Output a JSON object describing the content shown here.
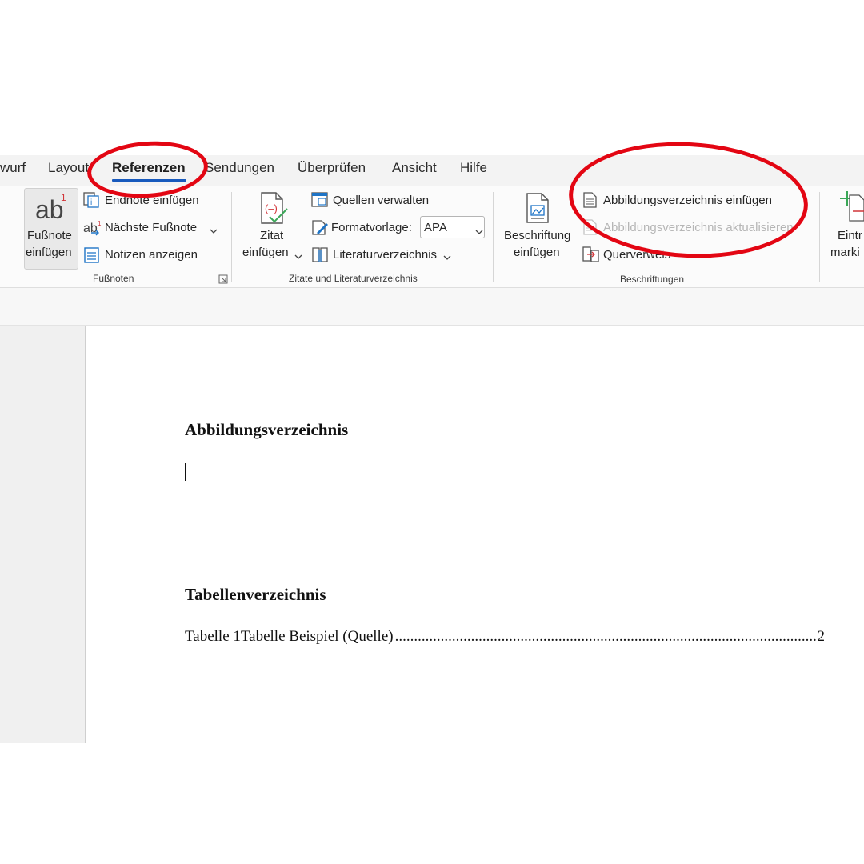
{
  "tabs": [
    {
      "label": "wurf",
      "active": false
    },
    {
      "label": "Layout",
      "active": false
    },
    {
      "label": "Referenzen",
      "active": true
    },
    {
      "label": "Sendungen",
      "active": false
    },
    {
      "label": "Überprüfen",
      "active": false
    },
    {
      "label": "Ansicht",
      "active": false
    },
    {
      "label": "Hilfe",
      "active": false
    }
  ],
  "ribbon": {
    "footnotes": {
      "insert_footnote": [
        "Fußnote",
        "einfügen"
      ],
      "insert_endnote": "Endnote einfügen",
      "next_footnote": "Nächste Fußnote",
      "show_notes": "Notizen anzeigen",
      "group_label": "Fußnoten"
    },
    "citations": {
      "insert_citation": [
        "Zitat",
        "einfügen"
      ],
      "manage_sources": "Quellen verwalten",
      "style_label": "Formatvorlage:",
      "style_value": "APA",
      "bibliography": "Literaturverzeichnis",
      "group_label": "Zitate und Literaturverzeichnis"
    },
    "captions": {
      "insert_caption": [
        "Beschriftung",
        "einfügen"
      ],
      "insert_tof": "Abbildungsverzeichnis einfügen",
      "update_tof": "Abbildungsverzeichnis aktualisieren",
      "cross_reference": "Querverweis",
      "group_label": "Beschriftungen"
    },
    "index": {
      "mark_entry": [
        "Eintr",
        "marki"
      ]
    }
  },
  "document": {
    "heading_figures": "Abbildungsverzeichnis",
    "heading_tables": "Tabellenverzeichnis",
    "toc_entry_text": "Tabelle 1Tabelle Beispiel (Quelle)",
    "toc_entry_page": "2"
  },
  "colors": {
    "accent": "#185abd",
    "annotation_red": "#e30613"
  },
  "icons": [
    "footnote-ab-icon",
    "endnote-icon",
    "next-footnote-icon",
    "show-notes-icon",
    "citation-icon",
    "manage-sources-icon",
    "style-icon",
    "bibliography-icon",
    "caption-icon",
    "tof-icon",
    "update-tof-icon",
    "cross-reference-icon",
    "mark-entry-icon",
    "dialog-launcher-icon",
    "chevron-down-icon"
  ]
}
